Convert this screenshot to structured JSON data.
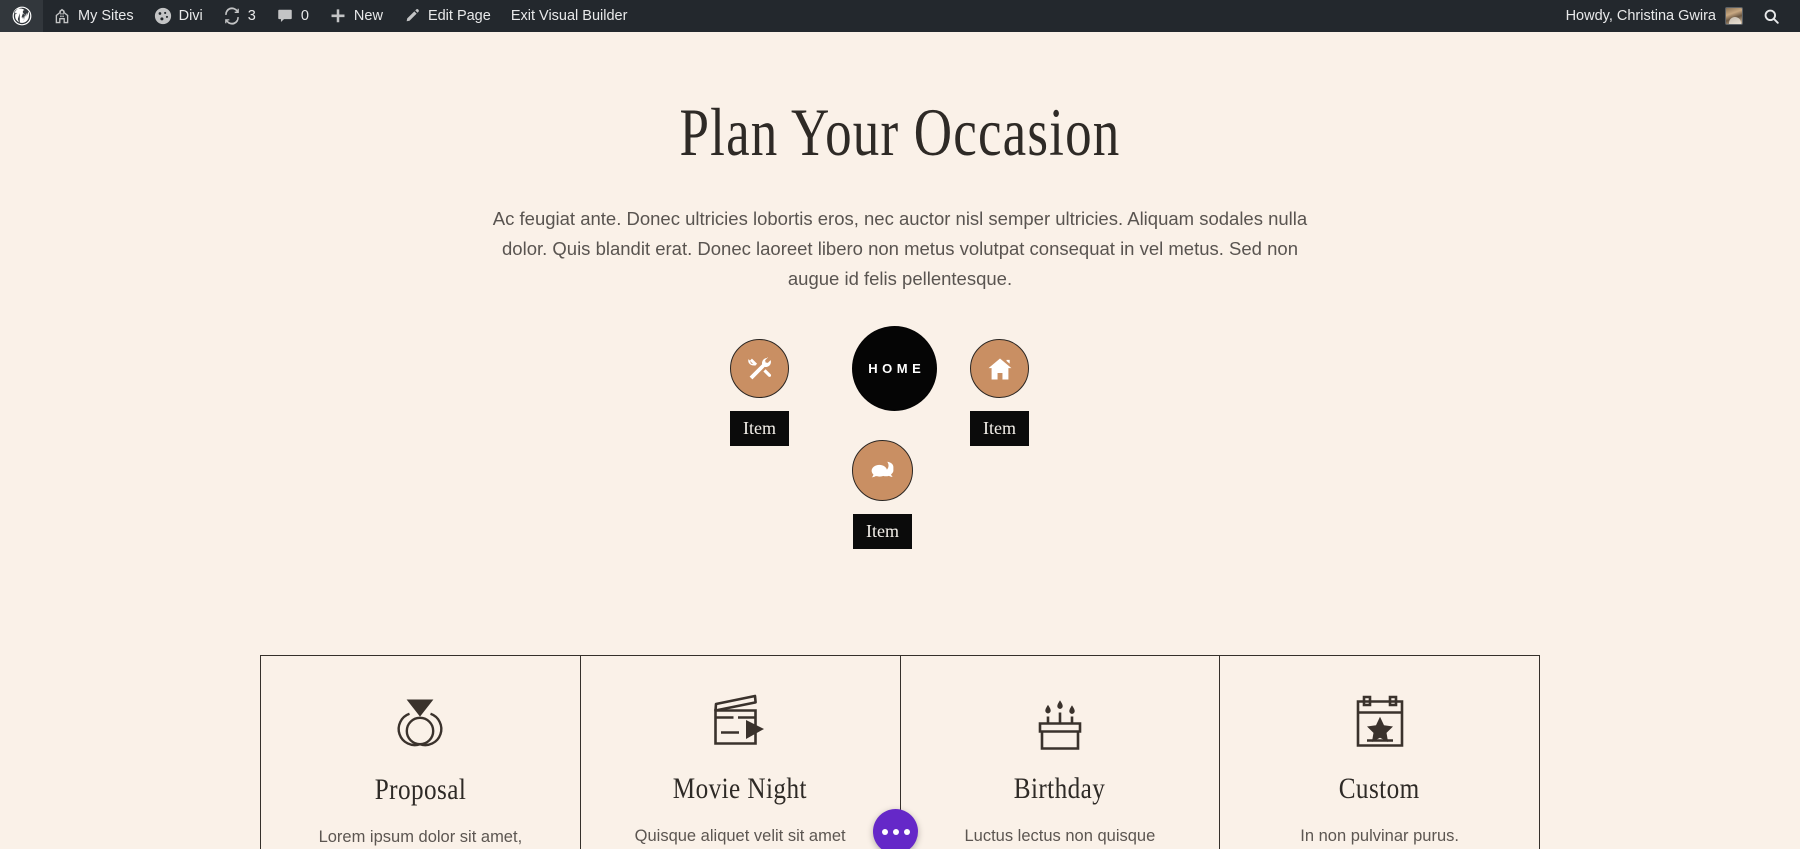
{
  "adminbar": {
    "left_items": [
      {
        "id": "wp-logo",
        "label": "",
        "icon": "wordpress-icon"
      },
      {
        "id": "my-sites",
        "label": "My Sites",
        "icon": "sites-icon"
      },
      {
        "id": "divi",
        "label": "Divi",
        "icon": "divi-icon"
      },
      {
        "id": "updates",
        "label": "3",
        "icon": "updates-icon"
      },
      {
        "id": "comments",
        "label": "0",
        "icon": "comment-icon"
      },
      {
        "id": "new",
        "label": "New",
        "icon": "plus-icon"
      },
      {
        "id": "edit-page",
        "label": "Edit Page",
        "icon": "pencil-icon"
      },
      {
        "id": "exit-vb",
        "label": "Exit Visual Builder",
        "icon": ""
      }
    ],
    "howdy": "Howdy, Christina Gwira",
    "search_icon": "search-icon",
    "bg_color": "#23282d"
  },
  "hero": {
    "title": "Plan Your Occasion",
    "paragraph": "Ac feugiat ante. Donec ultricies lobortis eros, nec auctor nisl semper ultricies. Aliquam sodales nulla dolor. Quis blandit erat. Donec laoreet libero non metus volutpat consequat in vel metus. Sed non augue id felis pellentesque."
  },
  "circle_nav": {
    "accent_color": "#c98f63",
    "center_color": "#050505",
    "center_label": "HOME",
    "nodes": [
      {
        "id": "tools",
        "icon": "tools-icon",
        "tooltip": "Item"
      },
      {
        "id": "house",
        "icon": "house-icon",
        "tooltip": "Item"
      },
      {
        "id": "chat",
        "icon": "chat-bubbles-icon",
        "tooltip": "Item"
      }
    ]
  },
  "cards": [
    {
      "icon": "diamond-ring-icon",
      "title": "Proposal",
      "text": "Lorem ipsum dolor sit amet,"
    },
    {
      "icon": "clapperboard-icon",
      "title": "Movie Night",
      "text": "Quisque aliquet velit sit amet"
    },
    {
      "icon": "birthday-cake-icon",
      "title": "Birthday",
      "text": "Luctus lectus non quisque"
    },
    {
      "icon": "calendar-star-icon",
      "title": "Custom",
      "text": "In non pulvinar purus."
    }
  ],
  "fab": {
    "name": "more-options-button",
    "color": "#6528c8"
  }
}
